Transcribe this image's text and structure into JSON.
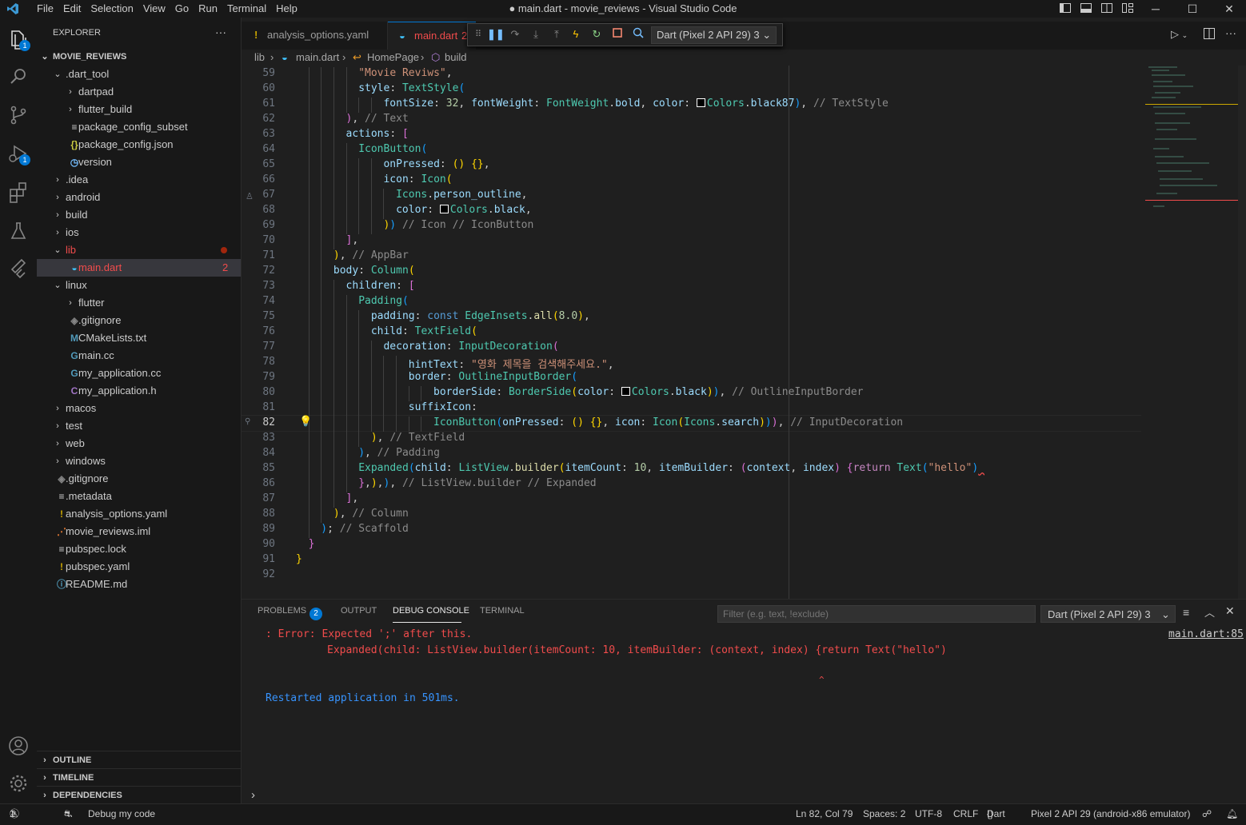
{
  "window": {
    "title": "● main.dart - movie_reviews - Visual Studio Code",
    "menu": [
      "File",
      "Edit",
      "Selection",
      "View",
      "Go",
      "Run",
      "Terminal",
      "Help"
    ]
  },
  "activity_bar": {
    "explorer_badge": "1",
    "debug_badge": "1"
  },
  "sidebar": {
    "title": "EXPLORER",
    "more": "···",
    "root": "MOVIE_REVIEWS",
    "items": [
      {
        "label": "~.dart_tool",
        "depth": 1,
        "icon": "chevron-down"
      },
      {
        "label": "dartpad",
        "depth": 2,
        "icon": "chevron-right"
      },
      {
        "label": "flutter_build",
        "depth": 2,
        "icon": "chevron-right"
      },
      {
        "label": "package_config_subset",
        "depth": 2,
        "icon": "lines"
      },
      {
        "label": "package_config.json",
        "depth": 2,
        "icon": "json"
      },
      {
        "label": "version",
        "depth": 2,
        "icon": "clock"
      },
      {
        "label": ".idea",
        "depth": 1,
        "icon": "chevron-right"
      },
      {
        "label": "android",
        "depth": 1,
        "icon": "chevron-right"
      },
      {
        "label": "build",
        "depth": 1,
        "icon": "chevron-right"
      },
      {
        "label": "ios",
        "depth": 1,
        "icon": "chevron-right"
      },
      {
        "label": "lib",
        "depth": 1,
        "icon": "chevron-down"
      },
      {
        "label": "main.dart",
        "depth": 2,
        "icon": "dart"
      },
      {
        "label": "linux",
        "depth": 1,
        "icon": "chevron-down"
      },
      {
        "label": "flutter",
        "depth": 2,
        "icon": "chevron-right"
      },
      {
        "label": ".gitignore",
        "depth": 2,
        "icon": "git"
      },
      {
        "label": "CMakeLists.txt",
        "depth": 2,
        "icon": "cmake"
      },
      {
        "label": "main.cc",
        "depth": 2,
        "icon": "cpp"
      },
      {
        "label": "my_application.cc",
        "depth": 2,
        "icon": "cpp"
      },
      {
        "label": "my_application.h",
        "depth": 2,
        "icon": "c"
      },
      {
        "label": "macos",
        "depth": 1,
        "icon": "chevron-right"
      },
      {
        "label": "test",
        "depth": 1,
        "icon": "chevron-right"
      },
      {
        "label": "web",
        "depth": 1,
        "icon": "chevron-right"
      },
      {
        "label": "windows",
        "depth": 1,
        "icon": "chevron-right"
      },
      {
        "label": ".gitignore",
        "depth": 1,
        "icon": "git"
      },
      {
        "label": ".metadata",
        "depth": 1,
        "icon": "lines"
      },
      {
        "label": "analysis_options.yaml",
        "depth": 1,
        "icon": "yaml"
      },
      {
        "label": "movie_reviews.iml",
        "depth": 1,
        "icon": "rss"
      },
      {
        "label": "pubspec.lock",
        "depth": 1,
        "icon": "lines"
      },
      {
        "label": "pubspec.yaml",
        "depth": 1,
        "icon": "yaml"
      },
      {
        "label": "README.md",
        "depth": 1,
        "icon": "info"
      }
    ],
    "lib_problem_count": "2",
    "sections": [
      "OUTLINE",
      "TIMELINE",
      "DEPENDENCIES"
    ]
  },
  "tabs": [
    {
      "label": "analysis_options.yaml",
      "icon": "!"
    },
    {
      "label": "main.dart",
      "badge": "2"
    }
  ],
  "debug_toolbar": {
    "session": "Dart (Pixel 2 API 29) 3"
  },
  "breadcrumb": [
    "lib",
    "main.dart",
    "HomePage",
    "build"
  ],
  "editor": {
    "current_line": "82",
    "lines": [
      {
        "n": "59",
        "indent": 5,
        "tokens": [
          [
            "str",
            "\"Movie Reviws\""
          ],
          [
            "p",
            ","
          ]
        ]
      },
      {
        "n": "60",
        "indent": 5,
        "tokens": [
          [
            "prop",
            "style"
          ],
          [
            "p",
            ": "
          ],
          [
            "cls",
            "TextStyle"
          ],
          [
            "b3",
            "("
          ]
        ]
      },
      {
        "n": "61",
        "indent": 7,
        "tokens": [
          [
            "prop",
            "fontSize"
          ],
          [
            "p",
            ": "
          ],
          [
            "num",
            "32"
          ],
          [
            "p",
            ", "
          ],
          [
            "prop",
            "fontWeight"
          ],
          [
            "p",
            ": "
          ],
          [
            "cls",
            "FontWeight"
          ],
          [
            "p",
            "."
          ],
          [
            "prop",
            "bold"
          ],
          [
            "p",
            ", "
          ],
          [
            "prop",
            "color"
          ],
          [
            "p",
            ": "
          ],
          [
            "sw",
            ""
          ],
          [
            "cls",
            "Colors"
          ],
          [
            "p",
            "."
          ],
          [
            "prop",
            "black87"
          ],
          [
            "b3",
            ")"
          ],
          [
            "p",
            ", "
          ],
          [
            "cmt",
            "// TextStyle"
          ]
        ]
      },
      {
        "n": "62",
        "indent": 4,
        "tokens": [
          [
            "b2",
            ")"
          ],
          [
            "p",
            ", "
          ],
          [
            "cmt",
            "// Text"
          ]
        ]
      },
      {
        "n": "63",
        "indent": 4,
        "tokens": [
          [
            "prop",
            "actions"
          ],
          [
            "p",
            ": "
          ],
          [
            "b2",
            "["
          ]
        ]
      },
      {
        "n": "64",
        "indent": 5,
        "tokens": [
          [
            "cls",
            "IconButton"
          ],
          [
            "b3",
            "("
          ]
        ]
      },
      {
        "n": "65",
        "indent": 7,
        "tokens": [
          [
            "prop",
            "onPressed"
          ],
          [
            "p",
            ": "
          ],
          [
            "b1",
            "()"
          ],
          [
            "p",
            " "
          ],
          [
            "b1",
            "{}"
          ],
          [
            "p",
            ","
          ]
        ]
      },
      {
        "n": "66",
        "indent": 7,
        "tokens": [
          [
            "prop",
            "icon"
          ],
          [
            "p",
            ": "
          ],
          [
            "cls",
            "Icon"
          ],
          [
            "b1",
            "("
          ]
        ]
      },
      {
        "n": "67",
        "indent": 8,
        "tokens": [
          [
            "cls",
            "Icons"
          ],
          [
            "p",
            "."
          ],
          [
            "prop",
            "person_outline"
          ],
          [
            "p",
            ","
          ]
        ]
      },
      {
        "n": "68",
        "indent": 8,
        "tokens": [
          [
            "prop",
            "color"
          ],
          [
            "p",
            ": "
          ],
          [
            "sw",
            ""
          ],
          [
            "cls",
            "Colors"
          ],
          [
            "p",
            "."
          ],
          [
            "prop",
            "black"
          ],
          [
            "p",
            ","
          ]
        ]
      },
      {
        "n": "69",
        "indent": 7,
        "tokens": [
          [
            "b1",
            ")"
          ],
          [
            "b3",
            ")"
          ],
          [
            "p",
            " "
          ],
          [
            "cmt",
            "// Icon // IconButton"
          ]
        ]
      },
      {
        "n": "70",
        "indent": 4,
        "tokens": [
          [
            "b2",
            "]"
          ],
          [
            "p",
            ","
          ]
        ]
      },
      {
        "n": "71",
        "indent": 3,
        "tokens": [
          [
            "b1",
            ")"
          ],
          [
            "p",
            ", "
          ],
          [
            "cmt",
            "// AppBar"
          ]
        ]
      },
      {
        "n": "72",
        "indent": 3,
        "tokens": [
          [
            "prop",
            "body"
          ],
          [
            "p",
            ": "
          ],
          [
            "cls",
            "Column"
          ],
          [
            "b1",
            "("
          ]
        ]
      },
      {
        "n": "73",
        "indent": 4,
        "tokens": [
          [
            "prop",
            "children"
          ],
          [
            "p",
            ": "
          ],
          [
            "b2",
            "["
          ]
        ]
      },
      {
        "n": "74",
        "indent": 5,
        "tokens": [
          [
            "cls",
            "Padding"
          ],
          [
            "b3",
            "("
          ]
        ]
      },
      {
        "n": "75",
        "indent": 6,
        "tokens": [
          [
            "prop",
            "padding"
          ],
          [
            "p",
            ": "
          ],
          [
            "kw",
            "const"
          ],
          [
            "p",
            " "
          ],
          [
            "cls",
            "EdgeInsets"
          ],
          [
            "p",
            "."
          ],
          [
            "fn",
            "all"
          ],
          [
            "b1",
            "("
          ],
          [
            "num",
            "8.0"
          ],
          [
            "b1",
            ")"
          ],
          [
            "p",
            ","
          ]
        ]
      },
      {
        "n": "76",
        "indent": 6,
        "tokens": [
          [
            "prop",
            "child"
          ],
          [
            "p",
            ": "
          ],
          [
            "cls",
            "TextField"
          ],
          [
            "b1",
            "("
          ]
        ]
      },
      {
        "n": "77",
        "indent": 7,
        "tokens": [
          [
            "prop",
            "decoration"
          ],
          [
            "p",
            ": "
          ],
          [
            "cls",
            "InputDecoration"
          ],
          [
            "b2",
            "("
          ]
        ]
      },
      {
        "n": "78",
        "indent": 9,
        "tokens": [
          [
            "prop",
            "hintText"
          ],
          [
            "p",
            ": "
          ],
          [
            "str",
            "\"영화 제목을 검색해주세요.\""
          ],
          [
            "p",
            ","
          ]
        ]
      },
      {
        "n": "79",
        "indent": 9,
        "tokens": [
          [
            "prop",
            "border"
          ],
          [
            "p",
            ": "
          ],
          [
            "cls",
            "OutlineInputBorder"
          ],
          [
            "b3",
            "("
          ]
        ]
      },
      {
        "n": "80",
        "indent": 11,
        "tokens": [
          [
            "prop",
            "borderSide"
          ],
          [
            "p",
            ": "
          ],
          [
            "cls",
            "BorderSide"
          ],
          [
            "b1",
            "("
          ],
          [
            "prop",
            "color"
          ],
          [
            "p",
            ": "
          ],
          [
            "sw",
            ""
          ],
          [
            "cls",
            "Colors"
          ],
          [
            "p",
            "."
          ],
          [
            "prop",
            "black"
          ],
          [
            "b1",
            ")"
          ],
          [
            "b3",
            ")"
          ],
          [
            "p",
            ", "
          ],
          [
            "cmt",
            "// OutlineInputBorder"
          ]
        ]
      },
      {
        "n": "81",
        "indent": 9,
        "tokens": [
          [
            "prop",
            "suffixIcon"
          ],
          [
            "p",
            ":"
          ]
        ]
      },
      {
        "n": "82",
        "indent": 11,
        "tokens": [
          [
            "cls",
            "IconButton"
          ],
          [
            "b3",
            "("
          ],
          [
            "prop",
            "onPressed"
          ],
          [
            "p",
            ": "
          ],
          [
            "b1",
            "()"
          ],
          [
            "p",
            " "
          ],
          [
            "b1",
            "{}"
          ],
          [
            "p",
            ", "
          ],
          [
            "prop",
            "icon"
          ],
          [
            "p",
            ": "
          ],
          [
            "cls",
            "Icon"
          ],
          [
            "b1",
            "("
          ],
          [
            "cls",
            "Icons"
          ],
          [
            "p",
            "."
          ],
          [
            "prop",
            "search"
          ],
          [
            "b1",
            ")"
          ],
          [
            "b3",
            ")"
          ],
          [
            "b2",
            ")"
          ],
          [
            "p",
            ", "
          ],
          [
            "cmt",
            "// InputDecoration"
          ]
        ]
      },
      {
        "n": "83",
        "indent": 6,
        "tokens": [
          [
            "b1",
            ")"
          ],
          [
            "p",
            ", "
          ],
          [
            "cmt",
            "// TextField"
          ]
        ]
      },
      {
        "n": "84",
        "indent": 5,
        "tokens": [
          [
            "b3",
            ")"
          ],
          [
            "p",
            ", "
          ],
          [
            "cmt",
            "// Padding"
          ]
        ]
      },
      {
        "n": "85",
        "indent": 5,
        "tokens": [
          [
            "cls",
            "Expanded"
          ],
          [
            "b3",
            "("
          ],
          [
            "prop",
            "child"
          ],
          [
            "p",
            ": "
          ],
          [
            "cls",
            "ListView"
          ],
          [
            "p",
            "."
          ],
          [
            "fn",
            "builder"
          ],
          [
            "b1",
            "("
          ],
          [
            "prop",
            "itemCount"
          ],
          [
            "p",
            ": "
          ],
          [
            "num",
            "10"
          ],
          [
            "p",
            ", "
          ],
          [
            "prop",
            "itemBuilder"
          ],
          [
            "p",
            ": "
          ],
          [
            "b2",
            "("
          ],
          [
            "prop",
            "context"
          ],
          [
            "p",
            ", "
          ],
          [
            "prop",
            "index"
          ],
          [
            "b2",
            ")"
          ],
          [
            "p",
            " "
          ],
          [
            "b2",
            "{"
          ],
          [
            "kw2",
            "return"
          ],
          [
            "p",
            " "
          ],
          [
            "cls",
            "Text"
          ],
          [
            "b3",
            "("
          ],
          [
            "str",
            "\"hello\""
          ],
          [
            "b3",
            ")"
          ]
        ]
      },
      {
        "n": "86",
        "indent": 5,
        "tokens": [
          [
            "b2",
            "}"
          ],
          [
            "p",
            ","
          ],
          [
            "b1",
            ")"
          ],
          [
            "p",
            ","
          ],
          [
            "b3",
            ")"
          ],
          [
            "p",
            ", "
          ],
          [
            "cmt",
            "// ListView.builder // Expanded"
          ]
        ]
      },
      {
        "n": "87",
        "indent": 4,
        "tokens": [
          [
            "b2",
            "]"
          ],
          [
            "p",
            ","
          ]
        ]
      },
      {
        "n": "88",
        "indent": 3,
        "tokens": [
          [
            "b1",
            ")"
          ],
          [
            "p",
            ", "
          ],
          [
            "cmt",
            "// Column"
          ]
        ]
      },
      {
        "n": "89",
        "indent": 2,
        "tokens": [
          [
            "b3",
            ")"
          ],
          [
            "p",
            "; "
          ],
          [
            "cmt",
            "// Scaffold"
          ]
        ]
      },
      {
        "n": "90",
        "indent": 1,
        "tokens": [
          [
            "b2",
            "}"
          ]
        ]
      },
      {
        "n": "91",
        "indent": 0,
        "tokens": [
          [
            "b1",
            "}"
          ]
        ]
      },
      {
        "n": "92",
        "indent": 0,
        "tokens": []
      }
    ]
  },
  "panel": {
    "tabs": [
      "PROBLEMS",
      "OUTPUT",
      "DEBUG CONSOLE",
      "TERMINAL"
    ],
    "problems_count": "2",
    "active_tab": "DEBUG CONSOLE",
    "filter_placeholder": "Filter (e.g. text, !exclude)",
    "session": "Dart (Pixel 2 API 29) 3",
    "console": {
      "error_line": ": Error: Expected ';' after this.",
      "error_code": "Expanded(child: ListView.builder(itemCount: 10, itemBuilder: (context, index) {return Text(\"hello\")",
      "caret": "^",
      "restart": "Restarted application in 501ms.",
      "source_link": "main.dart:85"
    },
    "prompt": "›"
  },
  "status_bar": {
    "errors": "1",
    "warnings": "1",
    "debug": "Debug my code",
    "position": "Ln 82, Col 79",
    "spaces": "Spaces: 2",
    "encoding": "UTF-8",
    "eol": "CRLF",
    "language": "Dart",
    "device": "Pixel 2 API 29 (android-x86 emulator)"
  },
  "colors": {
    "accent": "#0078d4",
    "error": "#f14c4c",
    "info": "#3794ff"
  }
}
